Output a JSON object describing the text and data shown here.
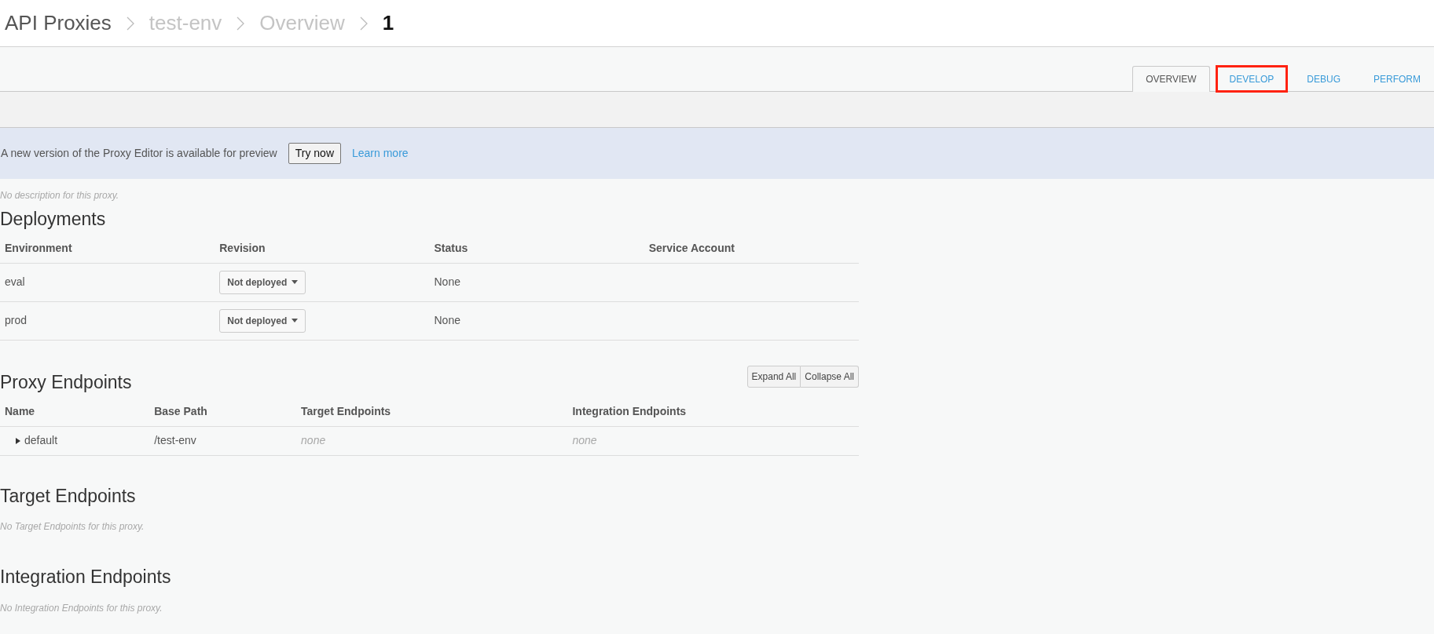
{
  "breadcrumb": [
    {
      "label": "API Proxies",
      "kind": "root"
    },
    {
      "label": "test-env",
      "kind": "link"
    },
    {
      "label": "Overview",
      "kind": "link"
    },
    {
      "label": "1",
      "kind": "current"
    }
  ],
  "tabs": [
    {
      "label": "OVERVIEW",
      "selected": true,
      "highlighted": false
    },
    {
      "label": "DEVELOP",
      "selected": false,
      "highlighted": true
    },
    {
      "label": "DEBUG",
      "selected": false,
      "highlighted": false
    },
    {
      "label": "PERFORM",
      "selected": false,
      "highlighted": false
    }
  ],
  "banner": {
    "message": "A new version of the Proxy Editor is available for preview",
    "button": "Try now",
    "link": "Learn more"
  },
  "description": "No description for this proxy.",
  "deployments": {
    "title": "Deployments",
    "columns": [
      "Environment",
      "Revision",
      "Status",
      "Service Account"
    ],
    "rows": [
      {
        "environment": "eval",
        "revision": "Not deployed",
        "status": "None"
      },
      {
        "environment": "prod",
        "revision": "Not deployed",
        "status": "None"
      }
    ]
  },
  "proxy_endpoints": {
    "title": "Proxy Endpoints",
    "buttons": [
      "Expand All",
      "Collapse All"
    ],
    "columns": [
      "Name",
      "Base Path",
      "Target Endpoints",
      "Integration Endpoints"
    ],
    "rows": [
      {
        "name": "default",
        "expanded": false,
        "base_path": "/test-env",
        "target_endpoints": "none",
        "integration_endpoints": "none"
      }
    ]
  },
  "target_endpoints": {
    "title": "Target Endpoints",
    "message": "No Target Endpoints for this proxy."
  },
  "integration_endpoints": {
    "title": "Integration Endpoints",
    "message": "No Integration Endpoints for this proxy."
  }
}
